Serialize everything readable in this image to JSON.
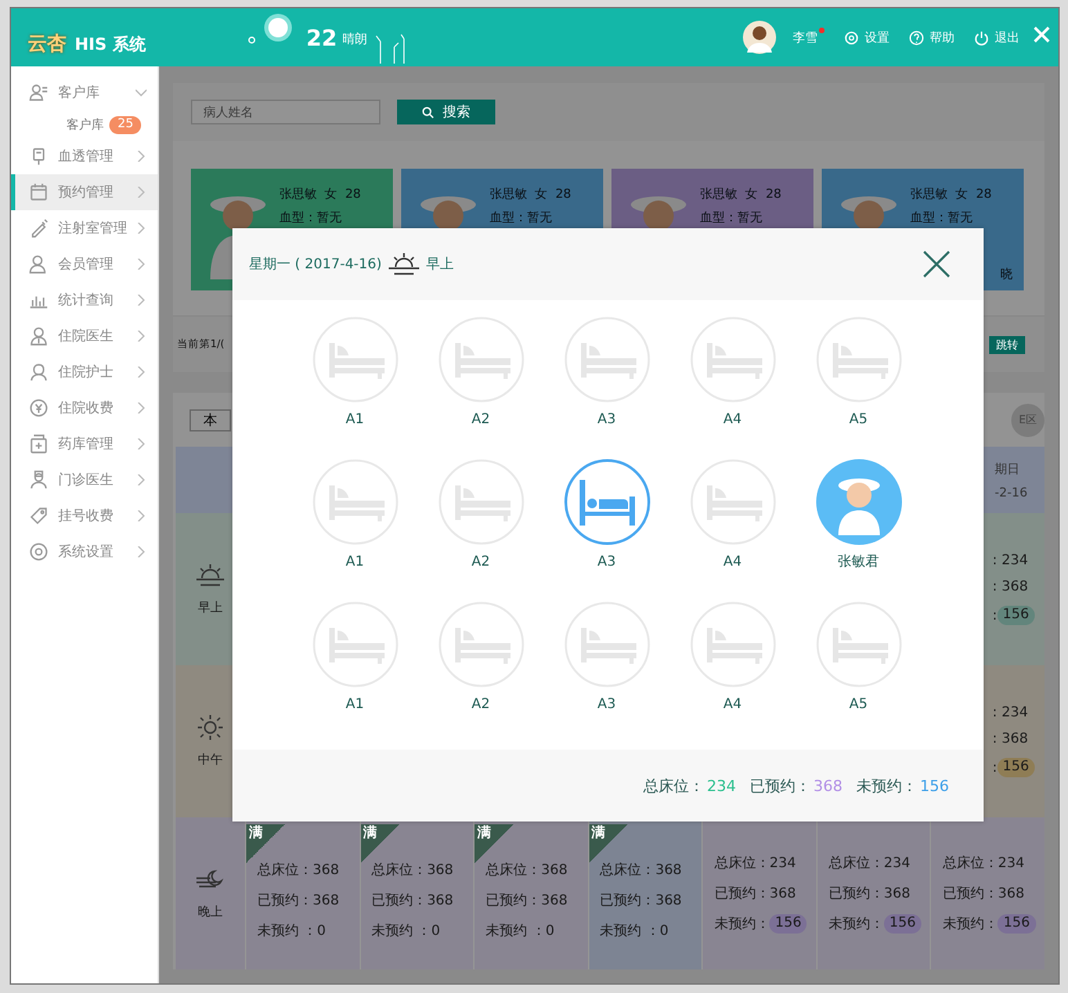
{
  "header": {
    "logo_mark": "云杏",
    "logo_text": "HIS 系统",
    "weather": {
      "temperature": "22",
      "condition": "晴朗"
    },
    "user": {
      "name": "李雪",
      "unread": true
    },
    "actions": [
      {
        "label": "设置"
      },
      {
        "label": "帮助"
      },
      {
        "label": "退出"
      }
    ]
  },
  "sidebar": {
    "items": [
      {
        "label": "客户库",
        "expanded": true,
        "selected": false,
        "children": [
          {
            "label": "客户库",
            "badge": "25"
          }
        ]
      },
      {
        "label": "血透管理",
        "expanded": false,
        "selected": false
      },
      {
        "label": "预约管理",
        "expanded": false,
        "selected": true
      },
      {
        "label": "注射室管理",
        "expanded": false,
        "selected": false
      },
      {
        "label": "会员管理",
        "expanded": false,
        "selected": false
      },
      {
        "label": "统计查询",
        "expanded": false,
        "selected": false
      },
      {
        "label": "住院医生",
        "expanded": false,
        "selected": false
      },
      {
        "label": "住院护士",
        "expanded": false,
        "selected": false
      },
      {
        "label": "住院收费",
        "expanded": false,
        "selected": false
      },
      {
        "label": "药库管理",
        "expanded": false,
        "selected": false
      },
      {
        "label": "门诊医生",
        "expanded": false,
        "selected": false
      },
      {
        "label": "挂号收费",
        "expanded": false,
        "selected": false
      },
      {
        "label": "系统设置",
        "expanded": false,
        "selected": false
      }
    ]
  },
  "search": {
    "placeholder": "病人姓名",
    "button": "搜索"
  },
  "patients": [
    {
      "title": "张思敏  女  28",
      "blood": "血型：暂无",
      "color": "#2b7a5a"
    },
    {
      "title": "张思敏  女  28",
      "blood": "血型：暂无",
      "color": "#39698a"
    },
    {
      "title": "张思敏  女  28",
      "blood": "血型：暂无",
      "color": "#6b5e84"
    },
    {
      "title": "张思敏  女  28",
      "blood": "血型：暂无",
      "color": "#39698a",
      "note": "晓"
    }
  ],
  "pager": {
    "info": "当前第1/(",
    "button": "跳转"
  },
  "schedule": {
    "tab": "本",
    "zone": "E区",
    "day_header": {
      "name": "期日",
      "date": "-2-16"
    },
    "rows": [
      {
        "period": "早上",
        "color": "#62857c",
        "cells": [
          {
            "kind": "partial",
            "total": ": 234",
            "booked": ": 368",
            "free_label": ":",
            "free": "156"
          }
        ]
      },
      {
        "period": "中午",
        "color": "#8f7d55",
        "cells": [
          {
            "kind": "partial",
            "total": ": 234",
            "booked": ": 368",
            "free_label": ":",
            "free": "156"
          }
        ]
      },
      {
        "period": "晚上",
        "color": "#7c7096",
        "cells": [
          {
            "kind": "full",
            "highlighted": false,
            "badge": "满",
            "total": "总床位：368",
            "booked": "已预约：368",
            "free_label": "未预约 ：0"
          },
          {
            "kind": "full",
            "highlighted": false,
            "badge": "满",
            "total": "总床位：368",
            "booked": "已预约：368",
            "free_label": "未预约 ：0"
          },
          {
            "kind": "full",
            "highlighted": false,
            "badge": "满",
            "total": "总床位：368",
            "booked": "已预约：368",
            "free_label": "未预约 ：0"
          },
          {
            "kind": "full",
            "highlighted": true,
            "badge": "满",
            "total": "总床位：368",
            "booked": "已预约：368",
            "free_label": "未预约 ：0"
          },
          {
            "kind": "open",
            "highlighted": false,
            "total": "总床位：234",
            "booked": "已预约：368",
            "free_label": "未预约：",
            "free": "156"
          },
          {
            "kind": "open",
            "highlighted": false,
            "total": "总床位：234",
            "booked": "已预约：368",
            "free_label": "未预约：",
            "free": "156"
          },
          {
            "kind": "open",
            "highlighted": false,
            "total": "总床位：234",
            "booked": "已预约：368",
            "free_label": "未预约：",
            "free": "156"
          }
        ]
      }
    ]
  },
  "modal": {
    "day": "星期一 ( 2017-4-16)",
    "period": "早上",
    "beds": [
      [
        {
          "label": "A1",
          "kind": "empty"
        },
        {
          "label": "A2",
          "kind": "empty"
        },
        {
          "label": "A3",
          "kind": "empty"
        },
        {
          "label": "A4",
          "kind": "empty"
        },
        {
          "label": "A5",
          "kind": "empty"
        }
      ],
      [
        {
          "label": "A1",
          "kind": "empty"
        },
        {
          "label": "A2",
          "kind": "empty"
        },
        {
          "label": "A3",
          "kind": "occupied"
        },
        {
          "label": "A4",
          "kind": "empty"
        },
        {
          "label": "张敏君",
          "kind": "patient"
        }
      ],
      [
        {
          "label": "A1",
          "kind": "empty"
        },
        {
          "label": "A2",
          "kind": "empty"
        },
        {
          "label": "A3",
          "kind": "empty"
        },
        {
          "label": "A4",
          "kind": "empty"
        },
        {
          "label": "A5",
          "kind": "empty"
        }
      ]
    ],
    "stats": [
      {
        "label": "总床位：",
        "value": "234",
        "color": "#2bbf8e"
      },
      {
        "label": "已预约：",
        "value": "368",
        "color": "#b28fe6"
      },
      {
        "label": "未预约：",
        "value": "156",
        "color": "#3d9fe8"
      }
    ]
  }
}
